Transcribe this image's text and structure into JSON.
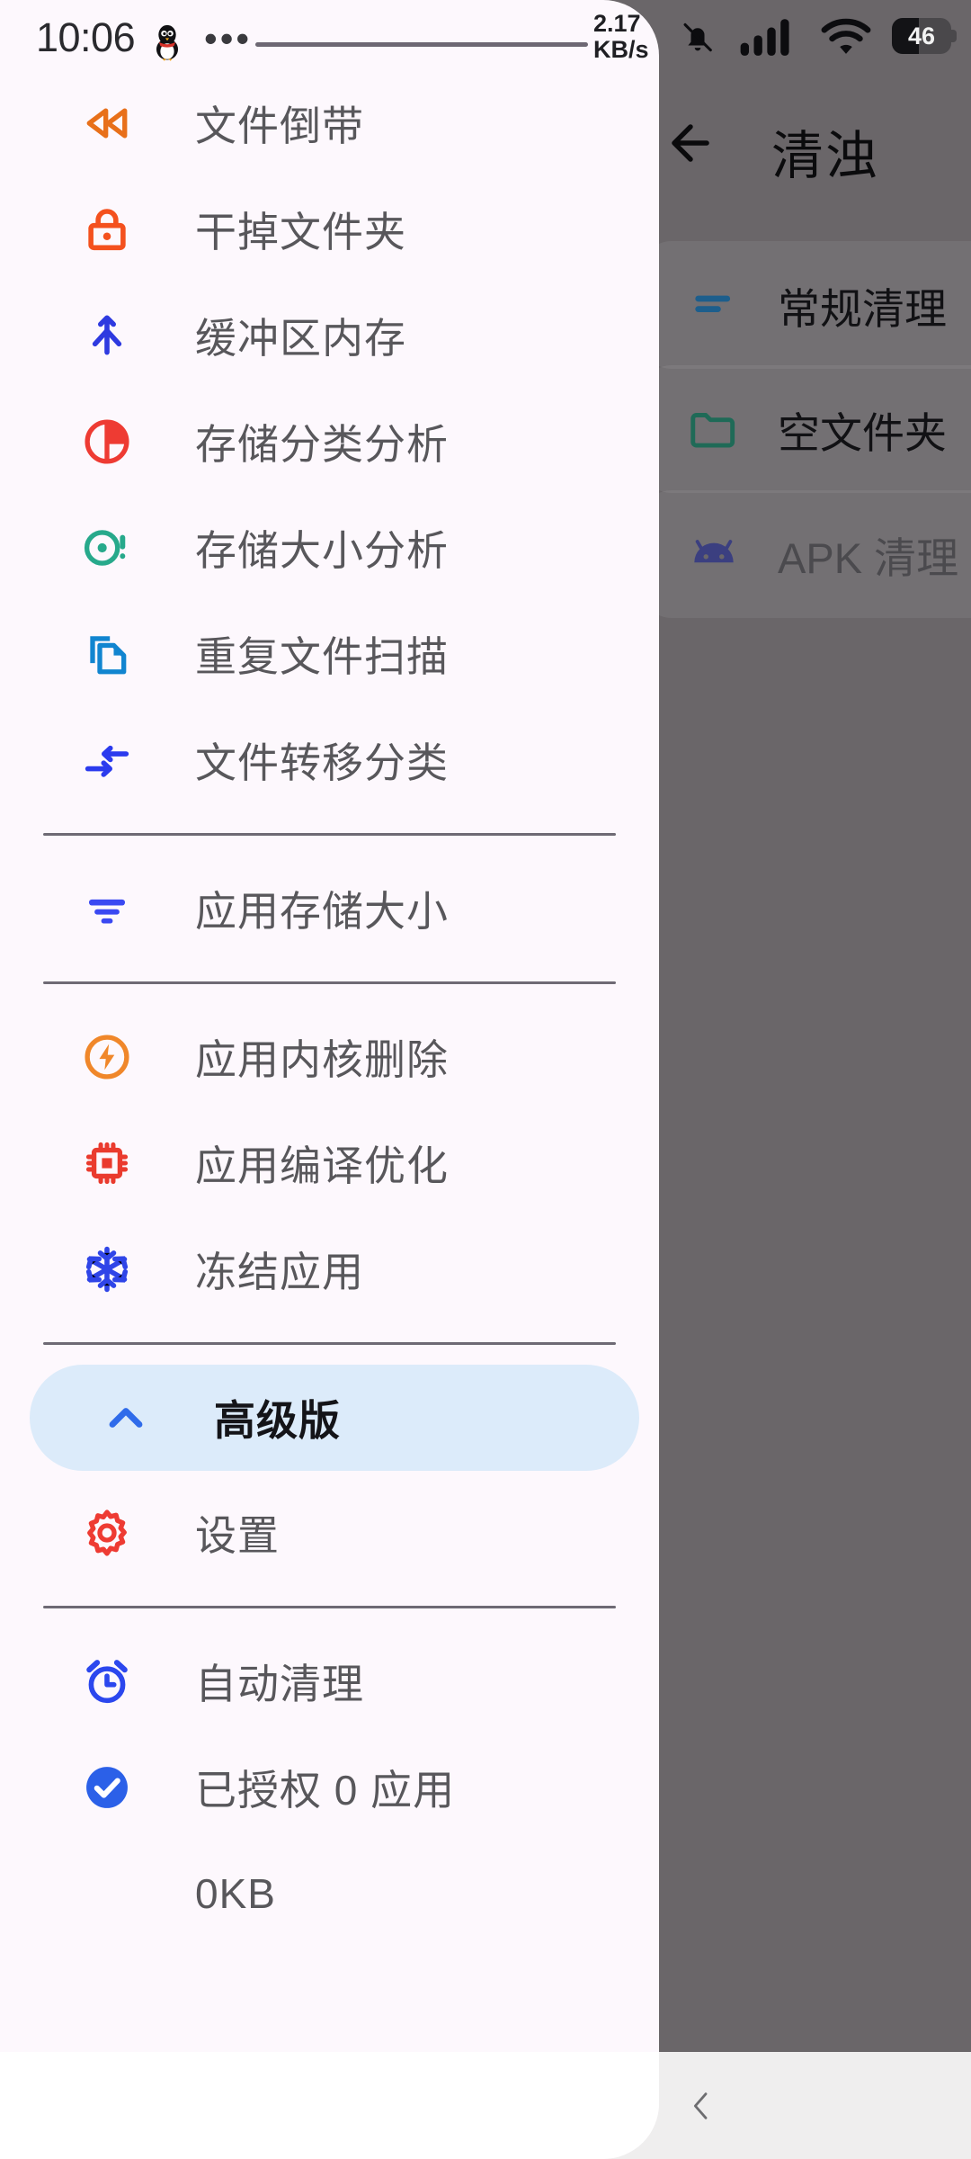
{
  "statusbar": {
    "time": "10:06",
    "penguin_icon": "qq-penguin-icon",
    "overflow_dots": "•••",
    "net_speed_value": "2.17",
    "net_speed_unit": "KB/s",
    "bell_icon": "bell-muted-icon",
    "signal_icon": "cellular-signal-icon",
    "wifi_icon": "wifi-icon",
    "battery_level": "46"
  },
  "background_app": {
    "back_icon": "arrow-left-icon",
    "title": "清浊",
    "cards": [
      {
        "icon": "lines-icon",
        "label": "常规清理",
        "color": "#1d5e8c",
        "muted": false
      },
      {
        "icon": "folder-icon",
        "label": "空文件夹",
        "color": "#1f6a57",
        "muted": false
      },
      {
        "icon": "android-icon",
        "label": "APK 清理",
        "color": "#3b3f80",
        "muted": true
      }
    ]
  },
  "drawer": {
    "groups": [
      {
        "items": [
          {
            "icon": "rewind-icon",
            "label": "文件倒带",
            "color": "#E8701A"
          },
          {
            "icon": "lock-icon",
            "label": "干掉文件夹",
            "color": "#F4511E"
          },
          {
            "icon": "merge-icon",
            "label": "缓冲区内存",
            "color": "#2E3AE0"
          },
          {
            "icon": "pie-chart-icon",
            "label": "存储分类分析",
            "color": "#EE3B33"
          },
          {
            "icon": "target-alert-icon",
            "label": "存储大小分析",
            "color": "#27A98B"
          },
          {
            "icon": "copy-files-icon",
            "label": "重复文件扫描",
            "color": "#1185D0"
          },
          {
            "icon": "transfer-icon",
            "label": "文件转移分类",
            "color": "#2B3BEE"
          }
        ]
      },
      {
        "items": [
          {
            "icon": "sort-lines-icon",
            "label": "应用存储大小",
            "color": "#3A49F2"
          }
        ]
      },
      {
        "items": [
          {
            "icon": "flash-circle-icon",
            "label": "应用内核删除",
            "color": "#F0872A"
          },
          {
            "icon": "cpu-chip-icon",
            "label": "应用编译优化",
            "color": "#EA3B2E"
          },
          {
            "icon": "snowflake-icon",
            "label": "冻结应用",
            "color": "#2F45E8"
          }
        ]
      },
      {
        "items": [
          {
            "icon": "chevron-up-icon",
            "label": "高级版",
            "color": "#2F6BEA",
            "selected": true
          },
          {
            "icon": "gear-icon",
            "label": "设置",
            "color": "#EE3B33"
          }
        ]
      },
      {
        "items": [
          {
            "icon": "alarm-clock-icon",
            "label": "自动清理",
            "color": "#2B47EE"
          },
          {
            "icon": "check-circle-icon",
            "label": "已授权 0 应用",
            "color": "#2B60E8"
          },
          {
            "icon": "none",
            "label": "0KB",
            "color": "#58575b"
          }
        ]
      }
    ]
  },
  "navbar": {
    "recents_icon": "recents-icon",
    "home_icon": "home-icon",
    "back_icon": "chevron-left-icon"
  },
  "colors": {
    "drawer_bg": "#fdf8fd",
    "scrim": "#6a6669",
    "selected_pill": "#dcebfa",
    "navbar_bg": "#efeeee"
  }
}
